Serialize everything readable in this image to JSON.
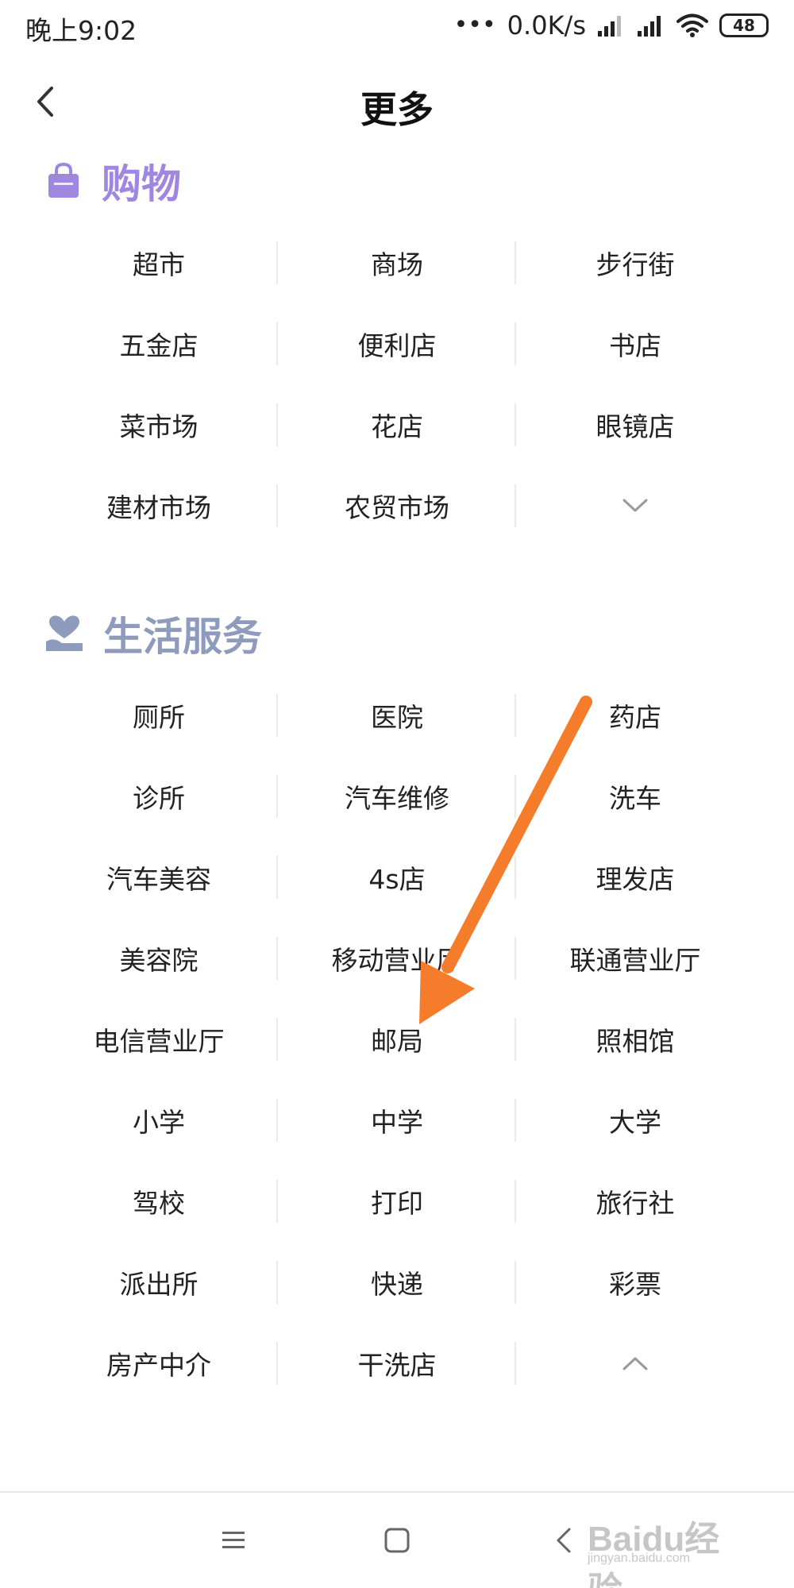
{
  "status_bar": {
    "time": "晚上9:02",
    "dots": "•••",
    "speed": "0.0K/s",
    "battery": "48"
  },
  "header": {
    "title": "更多",
    "back_icon": "chevron-left-icon"
  },
  "sections": [
    {
      "title": "购物",
      "icon": "shopping-bag-icon",
      "color": "#9f86e0",
      "rows": [
        [
          "超市",
          "商场",
          "步行街"
        ],
        [
          "五金店",
          "便利店",
          "书店"
        ],
        [
          "菜市场",
          "花店",
          "眼镜店"
        ],
        [
          "建材市场",
          "农贸市场",
          ""
        ]
      ],
      "expand_icon": "chevron-down-icon"
    },
    {
      "title": "生活服务",
      "icon": "heart-hand-icon",
      "color": "#8f9bbd",
      "rows": [
        [
          "厕所",
          "医院",
          "药店"
        ],
        [
          "诊所",
          "汽车维修",
          "洗车"
        ],
        [
          "汽车美容",
          "4s店",
          "理发店"
        ],
        [
          "美容院",
          "移动营业厅",
          "联通营业厅"
        ],
        [
          "电信营业厅",
          "邮局",
          "照相馆"
        ],
        [
          "小学",
          "中学",
          "大学"
        ],
        [
          "驾校",
          "打印",
          "旅行社"
        ],
        [
          "派出所",
          "快递",
          "彩票"
        ],
        [
          "房产中介",
          "干洗店",
          ""
        ]
      ],
      "collapse_icon": "chevron-up-icon"
    }
  ],
  "annotation": {
    "arrow_color": "#f57c2a"
  },
  "nav_bar": {
    "menu_icon": "menu-icon",
    "home_icon": "home-square-icon",
    "back_icon": "back-triangle-icon"
  },
  "watermark": {
    "text": "Baidu经验",
    "url": "jingyan.baidu.com"
  }
}
